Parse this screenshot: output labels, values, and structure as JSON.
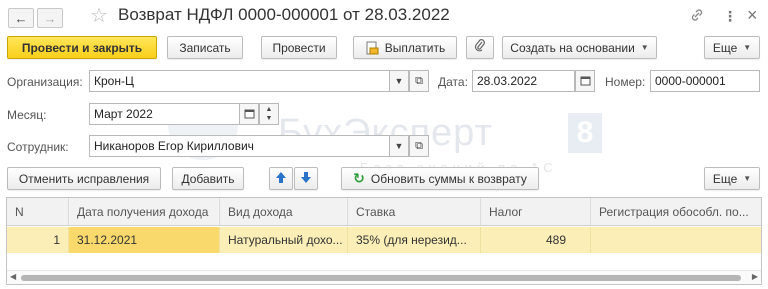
{
  "window": {
    "title": "Возврат НДФЛ 0000-000001 от 28.03.2022",
    "back_glyph": "←",
    "forward_glyph": "→",
    "star_glyph": "☆",
    "link_glyph": "🔗",
    "menu_glyph": "⋮",
    "close_glyph": "×"
  },
  "toolbar": {
    "post_and_close": "Провести и закрыть",
    "save": "Записать",
    "post": "Провести",
    "pay": "Выплатить",
    "create_based_on": "Создать на основании",
    "more": "Еще"
  },
  "form": {
    "organization_label": "Организация:",
    "organization_value": "Крон-Ц",
    "date_label": "Дата:",
    "date_value": "28.03.2022",
    "number_label": "Номер:",
    "number_value": "0000-000001",
    "month_label": "Месяц:",
    "month_value": "Март 2022",
    "employee_label": "Сотрудник:",
    "employee_value": "Никаноров Егор Кириллович"
  },
  "watermark": {
    "text": "БухЭксперт",
    "badge": "8",
    "subtitle": "База знаний по 1С"
  },
  "table_toolbar": {
    "cancel_corrections": "Отменить исправления",
    "add": "Добавить",
    "refresh_sums": "Обновить суммы к возврату",
    "more": "Еще"
  },
  "table": {
    "columns": [
      "N",
      "Дата получения дохода",
      "Вид дохода",
      "Ставка",
      "Налог",
      "Регистрация обособл. по..."
    ],
    "rows": [
      [
        "1",
        "31.12.2021",
        "Натуральный дохо...",
        "35% (для нерезид...",
        "489",
        ""
      ]
    ]
  },
  "colors": {
    "primary_button": "#f9cf1a",
    "selected_row": "#fbefb7",
    "selected_cell": "#f9d96b",
    "refresh_icon": "#2e9c3a",
    "arrow_icon": "#2b73c9"
  }
}
